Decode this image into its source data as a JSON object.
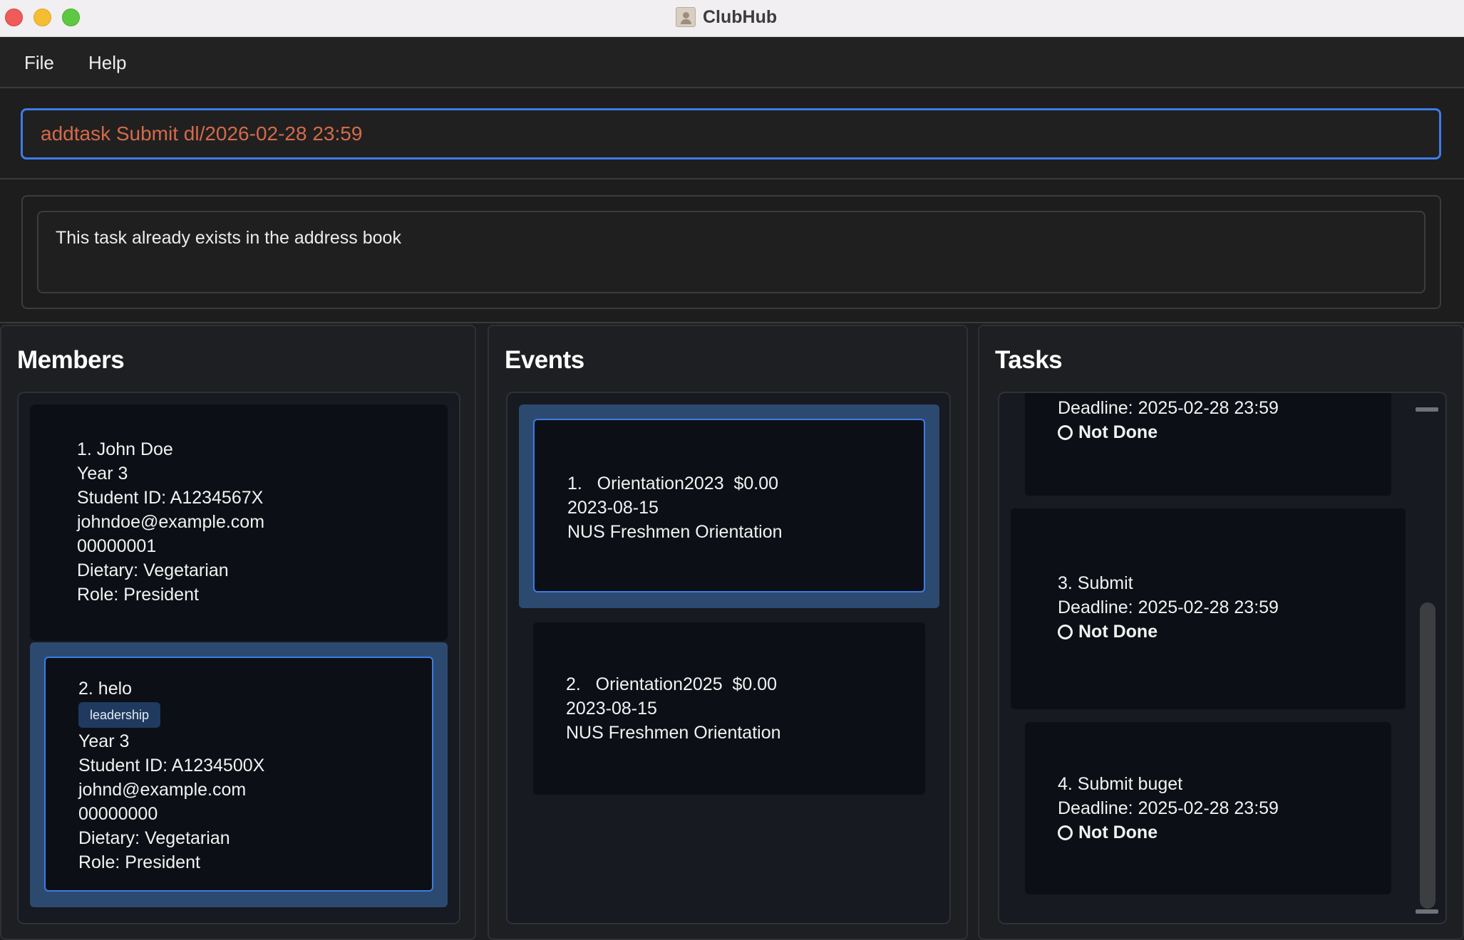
{
  "window": {
    "title": "ClubHub"
  },
  "menu": {
    "items": [
      "File",
      "Help"
    ]
  },
  "command": {
    "value": "addtask Submit dl/2026-02-28 23:59"
  },
  "result": {
    "message": "This task already exists in the address book"
  },
  "members": {
    "title": "Members",
    "items": [
      {
        "name": "1. John Doe",
        "tags": [],
        "year": "Year 3",
        "student_id": "Student ID: A1234567X",
        "email": "johndoe@example.com",
        "phone": "00000001",
        "dietary": "Dietary: Vegetarian",
        "role": "Role: President"
      },
      {
        "name": "2. helo",
        "tags": [
          "leadership"
        ],
        "year": "Year 3",
        "student_id": "Student ID: A1234500X",
        "email": "johnd@example.com",
        "phone": "00000000",
        "dietary": "Dietary: Vegetarian",
        "role": "Role: President"
      }
    ]
  },
  "events": {
    "title": "Events",
    "items": [
      {
        "header": "1.   Orientation2023  $0.00",
        "date": "2023-08-15",
        "description": "NUS Freshmen Orientation"
      },
      {
        "header": "2.   Orientation2025  $0.00",
        "date": "2023-08-15",
        "description": "NUS Freshmen Orientation"
      }
    ]
  },
  "tasks": {
    "title": "Tasks",
    "items": [
      {
        "deadline": "Deadline: 2025-02-28 23:59",
        "status": "Not Done"
      },
      {
        "name": "3. Submit",
        "deadline": "Deadline: 2025-02-28 23:59",
        "status": "Not Done"
      },
      {
        "name": "4. Submit buget",
        "deadline": "Deadline: 2025-02-28 23:59",
        "status": "Not Done"
      }
    ]
  },
  "icons": {
    "app": "contact-book-icon",
    "status": "circle-outline-icon"
  },
  "colors": {
    "accent": "#3d7ce6",
    "command_text": "#d56a4a",
    "selected_card": "#2c4a6f"
  }
}
